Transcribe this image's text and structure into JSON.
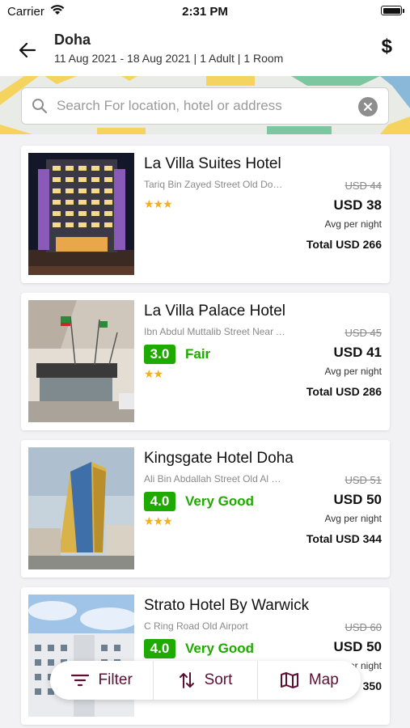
{
  "status_bar": {
    "carrier": "Carrier",
    "time": "2:31 PM"
  },
  "header": {
    "city": "Doha",
    "subtitle": "11 Aug 2021 - 18 Aug 2021 | 1 Adult | 1 Room",
    "currency_symbol": "$"
  },
  "search": {
    "placeholder": "Search For location, hotel or address"
  },
  "hotels": [
    {
      "name": "La Villa Suites Hotel",
      "address": "Tariq Bin Zayed Street Old Doha Airport",
      "stars": "★★★",
      "rating_score": "",
      "rating_label": "",
      "old_price": "USD 44",
      "price": "USD 38",
      "per_night": "Avg per night",
      "total": "Total USD 266"
    },
    {
      "name": "La Villa Palace Hotel",
      "address": "Ibn Abdul Muttalib Street Near Airport",
      "stars": "★★",
      "rating_score": "3.0",
      "rating_label": "Fair",
      "old_price": "USD 45",
      "price": "USD 41",
      "per_night": "Avg per night",
      "total": "Total USD 286"
    },
    {
      "name": "Kingsgate Hotel Doha",
      "address": "Ali Bin Abdallah Street Old Al Ghanim",
      "stars": "★★★",
      "rating_score": "4.0",
      "rating_label": "Very Good",
      "old_price": "USD 51",
      "price": "USD 50",
      "per_night": "Avg per night",
      "total": "Total USD 344"
    },
    {
      "name": "Strato Hotel By Warwick",
      "address": "C Ring Road Old Airport",
      "stars": "",
      "rating_score": "4.0",
      "rating_label": "Very Good",
      "old_price": "USD 60",
      "price": "USD 50",
      "per_night": "Avg per night",
      "total": "Total USD 350"
    }
  ],
  "actions": {
    "filter": "Filter",
    "sort": "Sort",
    "map": "Map"
  },
  "colors": {
    "accent": "#5b0f33",
    "rating_green": "#1faa00",
    "star": "#f2b01e"
  }
}
